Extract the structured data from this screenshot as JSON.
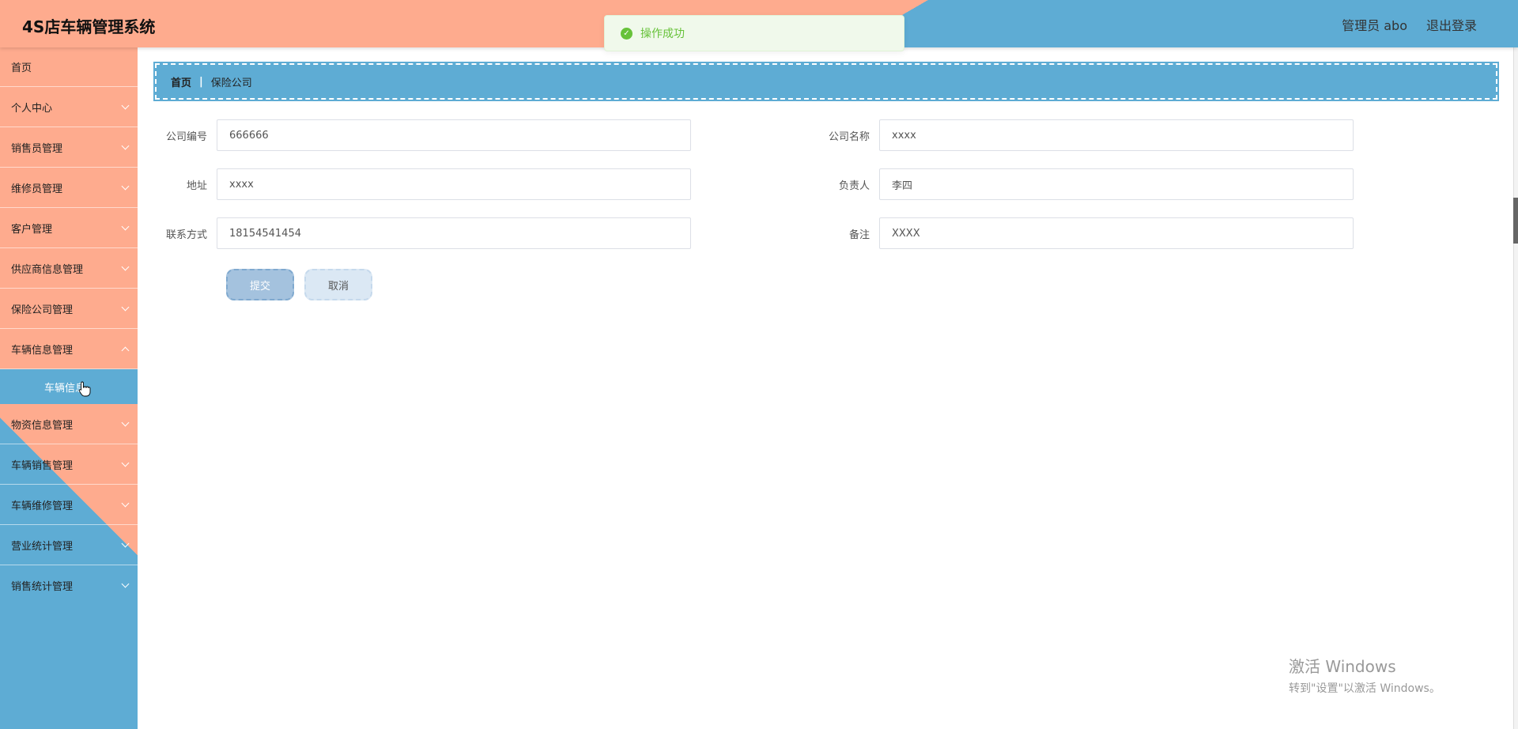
{
  "header": {
    "title": "4S店车辆管理系统",
    "user_label": "管理员 abo",
    "logout_label": "退出登录"
  },
  "toast": {
    "message": "操作成功"
  },
  "sidebar": {
    "items": [
      {
        "label": "首页"
      },
      {
        "label": "个人中心"
      },
      {
        "label": "销售员管理"
      },
      {
        "label": "维修员管理"
      },
      {
        "label": "客户管理"
      },
      {
        "label": "供应商信息管理"
      },
      {
        "label": "保险公司管理"
      },
      {
        "label": "车辆信息管理"
      },
      {
        "label": "物资信息管理"
      },
      {
        "label": "车辆销售管理"
      },
      {
        "label": "车辆维修管理"
      },
      {
        "label": "营业统计管理"
      },
      {
        "label": "销售统计管理"
      }
    ],
    "submenu_label": "车辆信息"
  },
  "breadcrumb": {
    "home": "首页",
    "current": "保险公司"
  },
  "form": {
    "company_id_label": "公司编号",
    "company_id_value": "666666",
    "company_name_label": "公司名称",
    "company_name_value": "xxxx",
    "address_label": "地址",
    "address_value": "xxxx",
    "manager_label": "负责人",
    "manager_value": "李四",
    "contact_label": "联系方式",
    "contact_value": "18154541454",
    "remark_label": "备注",
    "remark_value": "XXXX",
    "submit_label": "提交",
    "cancel_label": "取消"
  },
  "watermark": {
    "line1": "激活 Windows",
    "line2": "转到\"设置\"以激活 Windows。"
  },
  "colors": {
    "salmon": "#feab8e",
    "blue": "#5eacd4",
    "success": "#67c23a"
  }
}
